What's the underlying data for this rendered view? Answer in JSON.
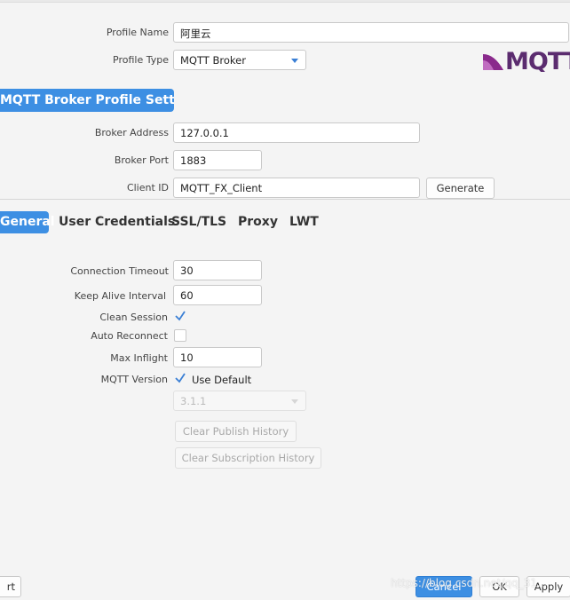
{
  "profile": {
    "name_label": "Profile Name",
    "name_value": "阿里云",
    "type_label": "Profile Type",
    "type_value": "MQTT Broker",
    "logo_text": "MQTT"
  },
  "section": {
    "title": "MQTT Broker Profile Settings"
  },
  "broker": {
    "address_label": "Broker Address",
    "address_value": "127.0.0.1",
    "port_label": "Broker Port",
    "port_value": "1883",
    "client_id_label": "Client ID",
    "client_id_value": "MQTT_FX_Client",
    "generate_label": "Generate"
  },
  "tabs": [
    {
      "label": "General",
      "active": true
    },
    {
      "label": "User Credentials",
      "active": false
    },
    {
      "label": "SSL/TLS",
      "active": false
    },
    {
      "label": "Proxy",
      "active": false
    },
    {
      "label": "LWT",
      "active": false
    }
  ],
  "general": {
    "timeout_label": "Connection Timeout",
    "timeout_value": "30",
    "keepalive_label": "Keep Alive Interval",
    "keepalive_value": "60",
    "clean_session_label": "Clean Session",
    "clean_session_checked": true,
    "auto_reconnect_label": "Auto Reconnect",
    "auto_reconnect_checked": false,
    "max_inflight_label": "Max Inflight",
    "max_inflight_value": "10",
    "mqtt_version_label": "MQTT Version",
    "use_default_label": "Use Default",
    "use_default_checked": true,
    "version_value": "3.1.1",
    "clear_publish_label": "Clear Publish History",
    "clear_subscription_label": "Clear Subscription History"
  },
  "footer": {
    "left_button_label": "rt",
    "cancel_label": "Cancel",
    "ok_label": "OK",
    "apply_label": "Apply"
  },
  "watermark": "https://blog.csdn.net/qq_31...",
  "colors": {
    "accent": "#3d8fe3",
    "logo_purple": "#8a2a8c"
  },
  "icons": [
    "dropdown-arrow-icon",
    "checkmark-icon",
    "mqtt-logo"
  ]
}
